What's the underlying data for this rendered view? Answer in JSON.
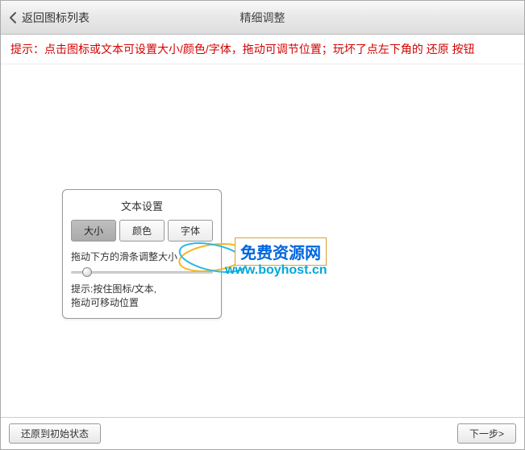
{
  "header": {
    "back_label": "返回图标列表",
    "title": "精细调整"
  },
  "hint": "提示：点击图标或文本可设置大小/颜色/字体，拖动可调节位置；玩坏了点左下角的 还原 按钮",
  "panel": {
    "title": "文本设置",
    "tabs": {
      "size": "大小",
      "color": "颜色",
      "font": "字体"
    },
    "slider_label": "拖动下方的滑条调整大小",
    "hint_line1": "提示:按住图标/文本,",
    "hint_line2": "拖动可移动位置"
  },
  "logo": {
    "box_text": "免费资源网",
    "url_text": "www.boyhost.cn"
  },
  "footer": {
    "reset_label": "还原到初始状态",
    "next_label": "下一步>"
  }
}
